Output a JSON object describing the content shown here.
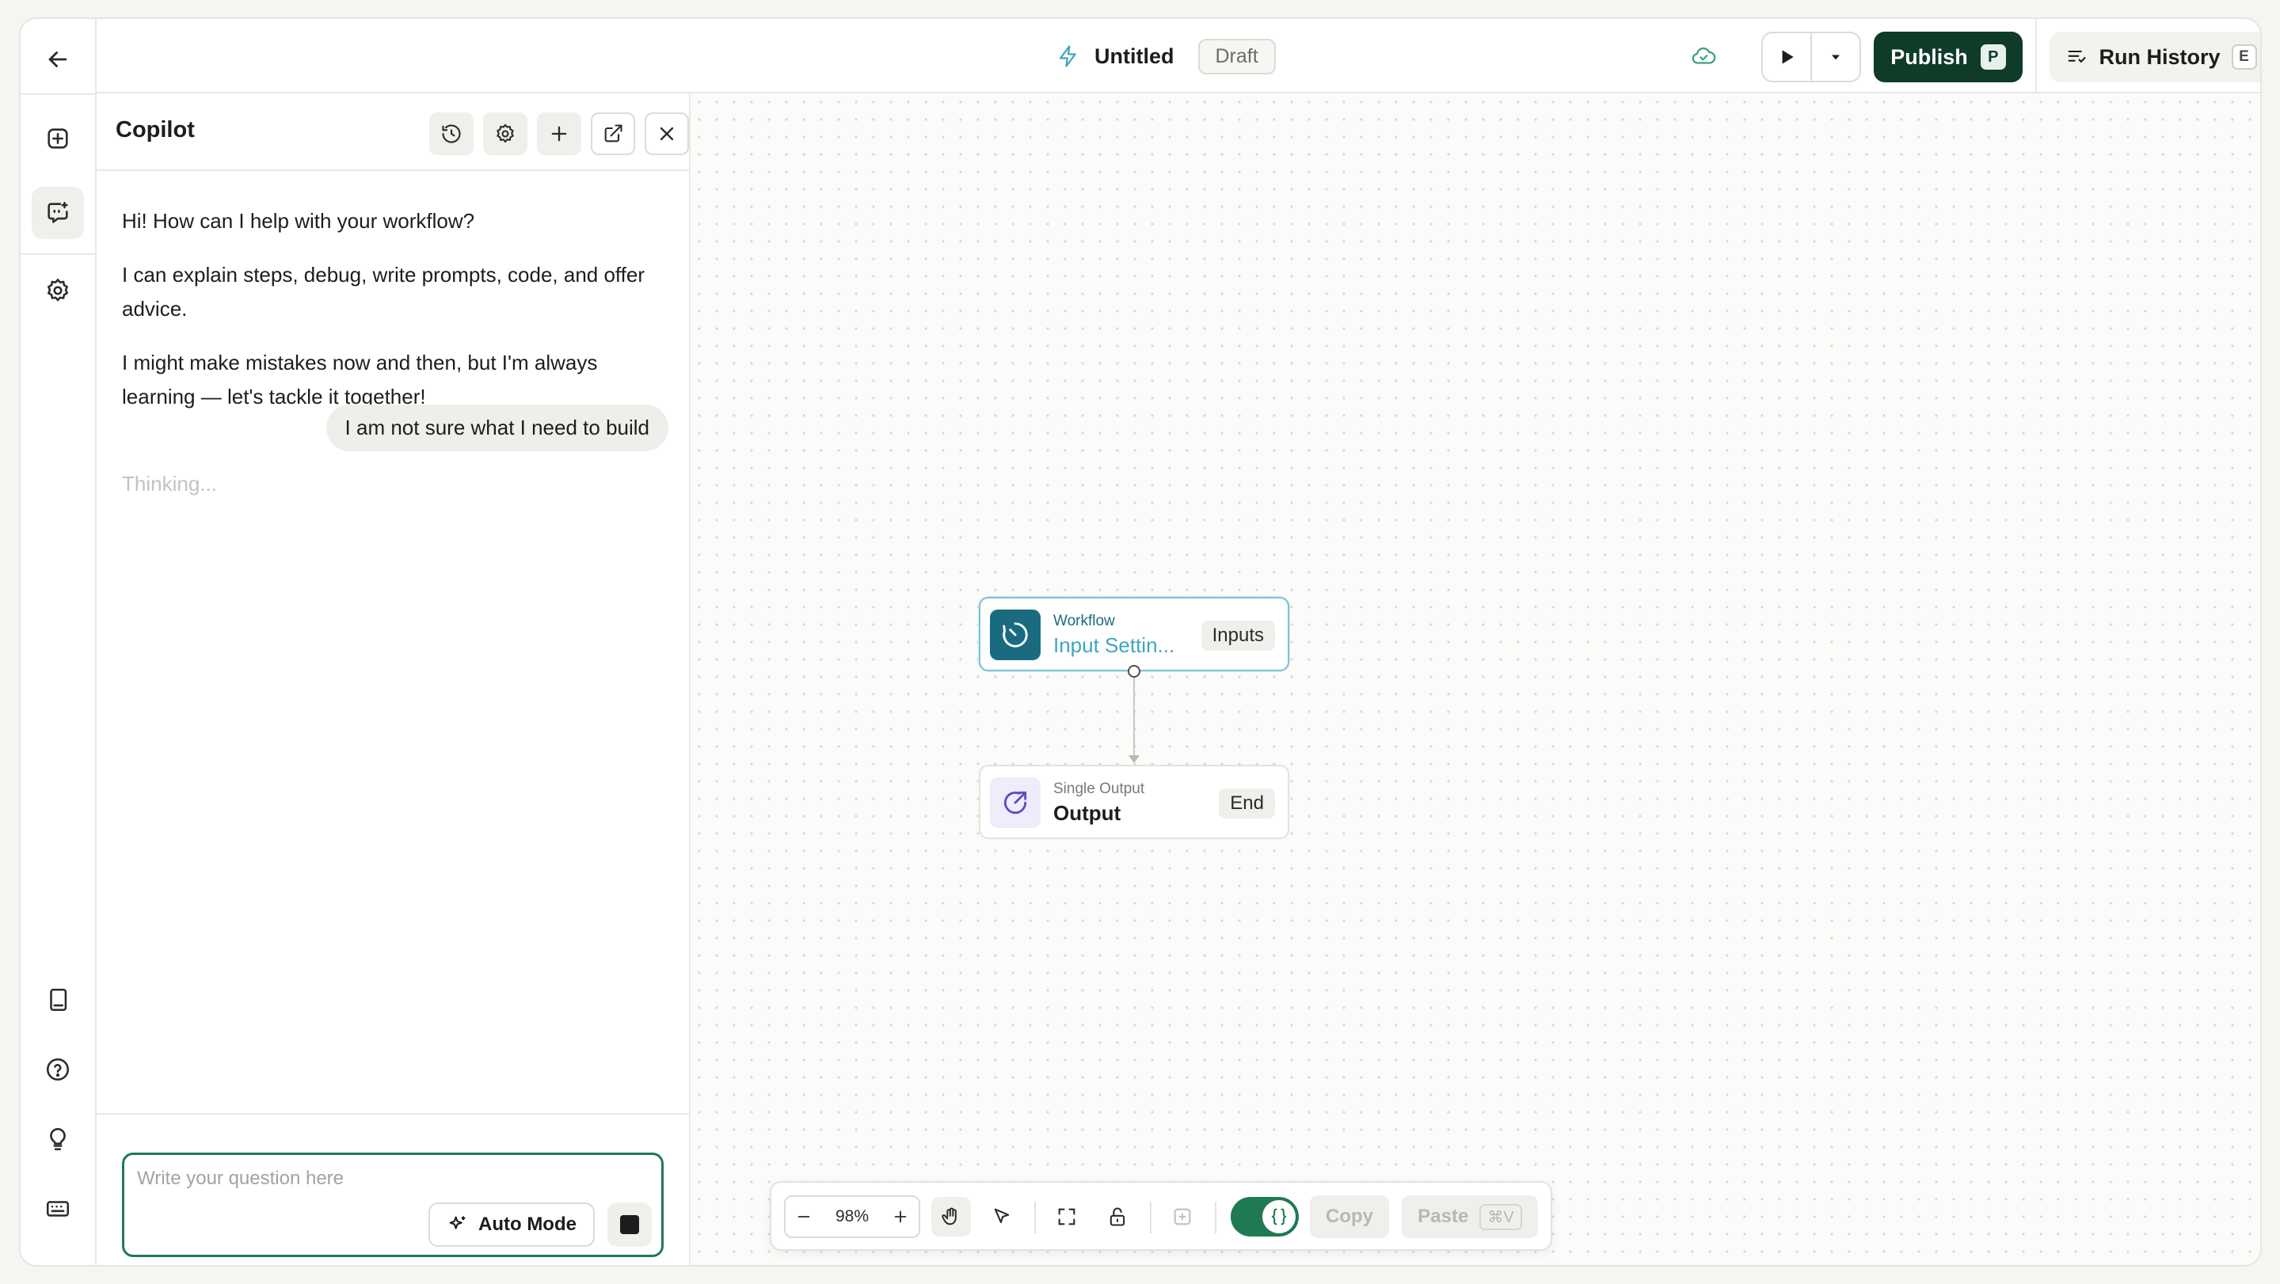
{
  "header": {
    "title": "Untitled",
    "status_badge": "Draft",
    "publish_label": "Publish",
    "publish_shortcut": "P",
    "run_history_label": "Run History",
    "run_history_shortcut": "E"
  },
  "copilot": {
    "title": "Copilot",
    "messages": [
      "Hi! How can I help with your workflow?",
      "I can explain steps, debug, write prompts, code, and offer advice.",
      "I might make mistakes now and then, but I'm always learning — let's tackle it together!"
    ],
    "user_message": "I am not sure what I need to build",
    "status": "Thinking...",
    "input_placeholder": "Write your question here",
    "mode_label": "Auto Mode"
  },
  "nodes": [
    {
      "kind": "Workflow",
      "title": "Input Settin...",
      "tag": "Inputs"
    },
    {
      "kind": "Single Output",
      "title": "Output",
      "tag": "End"
    }
  ],
  "toolbar": {
    "zoom": "98%",
    "copy_label": "Copy",
    "paste_label": "Paste",
    "paste_shortcut": "⌘V"
  },
  "colors": {
    "brand_dark_green": "#0f3b29",
    "accent_green": "#1f7a52",
    "input_node_teal": "#1b6b80",
    "output_node_purple": "#5a4fc4"
  }
}
